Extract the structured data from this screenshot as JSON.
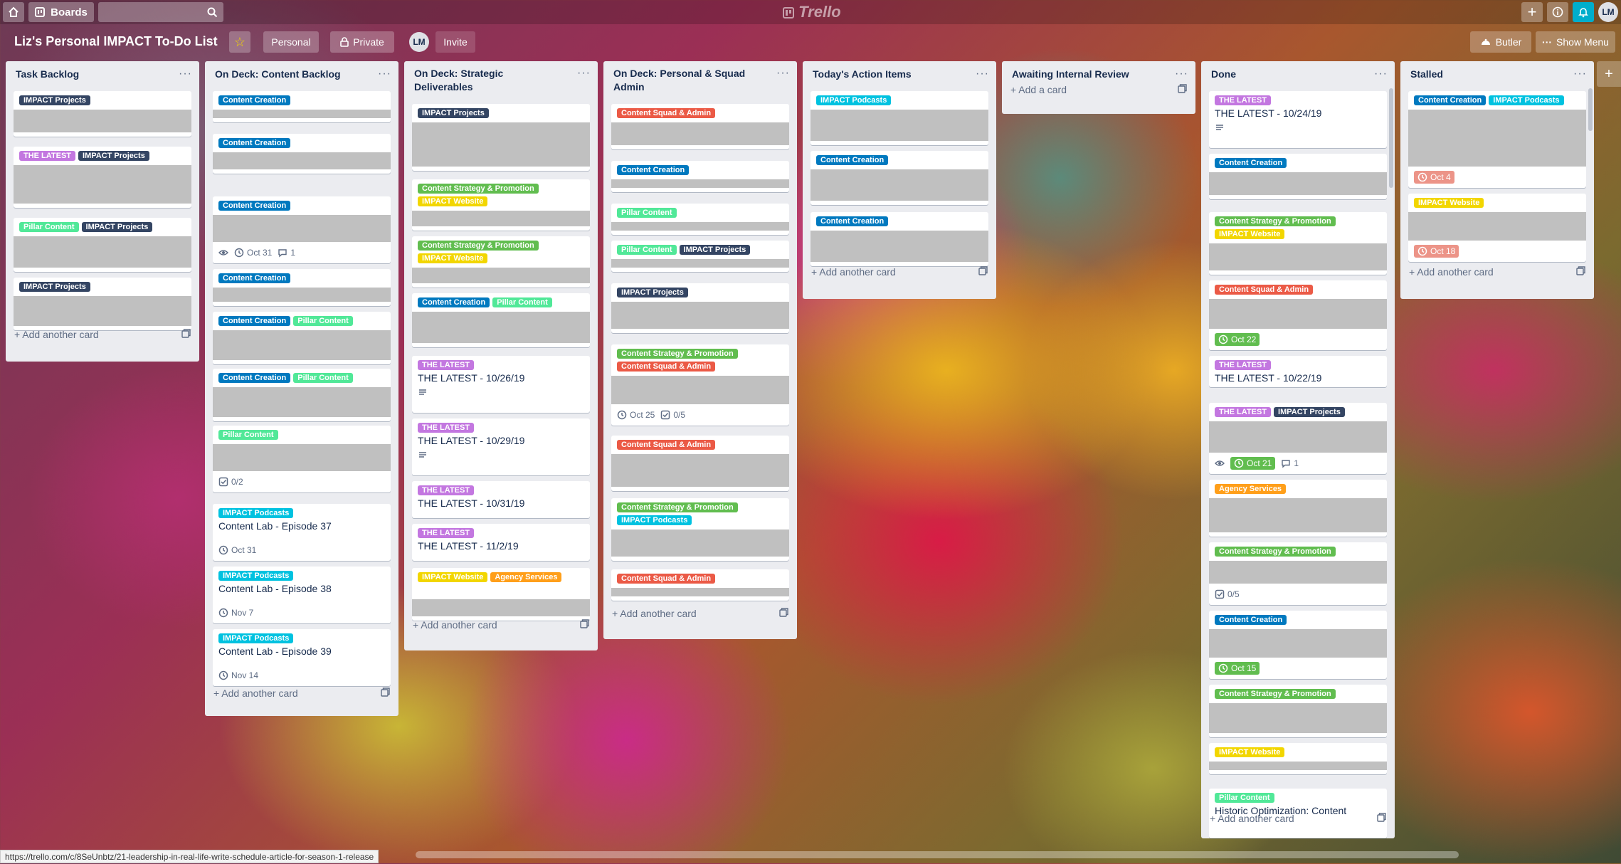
{
  "app": {
    "logo": "Trello"
  },
  "topbar": {
    "boards_label": "Boards",
    "avatar_initials": "LM"
  },
  "board": {
    "title": "Liz's Personal IMPACT To-Do List",
    "team_label": "Personal",
    "visibility_label": "Private",
    "invite_label": "Invite",
    "member_initials": "LM",
    "butler_label": "Butler",
    "show_menu_label": "Show Menu"
  },
  "colors": {
    "green": "#61bd4f",
    "yellow": "#f2d600",
    "orange": "#ff9f1a",
    "red": "#eb5a46",
    "purple": "#c377e0",
    "sky": "#00c2e0",
    "lime": "#51e898",
    "blue": "#0079bf",
    "navy": "#344563",
    "due_complete": "#61bd4f",
    "due_overdue": "#ec9488"
  },
  "lists": [
    {
      "title": "Task Backlog",
      "add_label": "Add another card",
      "cards": [
        {
          "labels": [
            [
              "IMPACT Projects",
              "navy"
            ]
          ]
        },
        {
          "labels": [
            [
              "THE LATEST",
              "purple"
            ],
            [
              "IMPACT Projects",
              "navy"
            ]
          ]
        },
        {
          "labels": [
            [
              "Pillar Content",
              "lime"
            ],
            [
              "IMPACT Projects",
              "navy"
            ]
          ]
        },
        {
          "labels": [
            [
              "IMPACT Projects",
              "navy"
            ]
          ]
        }
      ]
    },
    {
      "title": "On Deck: Content Backlog",
      "add_label": "Add another card",
      "cards": [
        {
          "labels": [
            [
              "Content Creation",
              "blue"
            ]
          ]
        },
        {
          "labels": [
            [
              "Content Creation",
              "blue"
            ]
          ]
        },
        {
          "labels": [
            [
              "Content Creation",
              "blue"
            ]
          ],
          "badges": {
            "due": "Oct 31",
            "comments": "1"
          }
        },
        {
          "labels": [
            [
              "Content Creation",
              "blue"
            ]
          ]
        },
        {
          "labels": [
            [
              "Content Creation",
              "blue"
            ],
            [
              "Pillar Content",
              "lime"
            ]
          ]
        },
        {
          "labels": [
            [
              "Content Creation",
              "blue"
            ],
            [
              "Pillar Content",
              "lime"
            ]
          ]
        },
        {
          "labels": [
            [
              "Pillar Content",
              "lime"
            ]
          ],
          "badges": {
            "checklist": "0/2"
          }
        },
        {
          "labels": [
            [
              "IMPACT Podcasts",
              "sky"
            ]
          ],
          "title": "Content Lab - Episode 37",
          "badges": {
            "due": "Oct 31"
          }
        },
        {
          "labels": [
            [
              "IMPACT Podcasts",
              "sky"
            ]
          ],
          "title": "Content Lab - Episode 38",
          "badges": {
            "due": "Nov 7"
          }
        },
        {
          "labels": [
            [
              "IMPACT Podcasts",
              "sky"
            ]
          ],
          "title": "Content Lab - Episode 39",
          "badges": {
            "due": "Nov 14"
          }
        }
      ]
    },
    {
      "title": "On Deck: Strategic Deliverables",
      "add_label": "Add another card",
      "cards": [
        {
          "labels": [
            [
              "IMPACT Projects",
              "navy"
            ]
          ]
        },
        {
          "labels": [
            [
              "Content Strategy & Promotion",
              "green"
            ],
            [
              "IMPACT Website",
              "yellow"
            ]
          ]
        },
        {
          "labels": [
            [
              "Content Strategy & Promotion",
              "green"
            ],
            [
              "IMPACT Website",
              "yellow"
            ]
          ]
        },
        {
          "labels": [
            [
              "Content Creation",
              "blue"
            ],
            [
              "Pillar Content",
              "lime"
            ]
          ]
        },
        {
          "labels": [
            [
              "THE LATEST",
              "purple"
            ]
          ],
          "title": "THE LATEST - 10/26/19"
        },
        {
          "labels": [
            [
              "THE LATEST",
              "purple"
            ]
          ],
          "title": "THE LATEST - 10/29/19"
        },
        {
          "labels": [
            [
              "THE LATEST",
              "purple"
            ]
          ],
          "title": "THE LATEST - 10/31/19"
        },
        {
          "labels": [
            [
              "THE LATEST",
              "purple"
            ]
          ],
          "title": "THE LATEST - 11/2/19"
        },
        {
          "labels": [
            [
              "IMPACT Website",
              "yellow"
            ],
            [
              "Agency Services",
              "orange"
            ]
          ]
        }
      ]
    },
    {
      "title": "On Deck: Personal & Squad Admin",
      "add_label": "Add another card",
      "cards": [
        {
          "labels": [
            [
              "Content Squad & Admin",
              "red"
            ]
          ]
        },
        {
          "labels": [
            [
              "Content Creation",
              "blue"
            ]
          ]
        },
        {
          "labels": [
            [
              "Pillar Content",
              "lime"
            ]
          ]
        },
        {
          "labels": [
            [
              "Pillar Content",
              "lime"
            ],
            [
              "IMPACT Projects",
              "navy"
            ]
          ]
        },
        {
          "labels": [
            [
              "IMPACT Projects",
              "navy"
            ]
          ]
        },
        {
          "labels": [
            [
              "Content Strategy & Promotion",
              "green"
            ],
            [
              "Content Squad & Admin",
              "red"
            ]
          ],
          "badges": {
            "due": "Oct 25",
            "checklist": "0/5"
          }
        },
        {
          "labels": [
            [
              "Content Squad & Admin",
              "red"
            ]
          ]
        },
        {
          "labels": [
            [
              "Content Strategy & Promotion",
              "green"
            ],
            [
              "IMPACT Podcasts",
              "sky"
            ]
          ]
        },
        {
          "labels": [
            [
              "Content Squad & Admin",
              "red"
            ]
          ]
        }
      ]
    },
    {
      "title": "Today's Action Items",
      "add_label": "Add another card",
      "cards": [
        {
          "labels": [
            [
              "IMPACT Podcasts",
              "sky"
            ]
          ]
        },
        {
          "labels": [
            [
              "Content Creation",
              "blue"
            ]
          ]
        },
        {
          "labels": [
            [
              "Content Creation",
              "blue"
            ]
          ]
        }
      ]
    },
    {
      "title": "Awaiting Internal Review",
      "add_label": "Add a card",
      "cards": []
    },
    {
      "title": "Done",
      "add_label": "Add another card",
      "cards": [
        {
          "labels": [
            [
              "THE LATEST",
              "purple"
            ]
          ],
          "title": "THE LATEST - 10/24/19"
        },
        {
          "labels": [
            [
              "Content Creation",
              "blue"
            ]
          ]
        },
        {
          "labels": [
            [
              "Content Strategy & Promotion",
              "green"
            ],
            [
              "IMPACT Website",
              "yellow"
            ]
          ]
        },
        {
          "labels": [
            [
              "Content Squad & Admin",
              "red"
            ]
          ],
          "badges": {
            "due": "Oct 22"
          }
        },
        {
          "labels": [
            [
              "THE LATEST",
              "purple"
            ]
          ],
          "title": "THE LATEST - 10/22/19"
        },
        {
          "labels": [
            [
              "THE LATEST",
              "purple"
            ],
            [
              "IMPACT Projects",
              "navy"
            ]
          ],
          "badges": {
            "due": "Oct 21",
            "comments": "1"
          }
        },
        {
          "labels": [
            [
              "Agency Services",
              "orange"
            ]
          ]
        },
        {
          "labels": [
            [
              "Content Strategy & Promotion",
              "green"
            ]
          ],
          "badges": {
            "checklist": "0/5"
          }
        },
        {
          "labels": [
            [
              "Content Creation",
              "blue"
            ]
          ],
          "badges": {
            "due": "Oct 15"
          }
        },
        {
          "labels": [
            [
              "Content Strategy & Promotion",
              "green"
            ]
          ]
        },
        {
          "labels": [
            [
              "IMPACT Website",
              "yellow"
            ]
          ]
        },
        {
          "labels": [
            [
              "Pillar Content",
              "lime"
            ]
          ],
          "title": "Historic Optimization: Content"
        }
      ]
    },
    {
      "title": "Stalled",
      "add_label": "Add another card",
      "cards": [
        {
          "labels": [
            [
              "Content Creation",
              "blue"
            ],
            [
              "IMPACT Podcasts",
              "sky"
            ]
          ],
          "badges": {
            "due": "Oct 4"
          }
        },
        {
          "labels": [
            [
              "IMPACT Website",
              "yellow"
            ]
          ],
          "badges": {
            "due": "Oct 18"
          }
        }
      ]
    }
  ],
  "status_url": "https://trello.com/c/8SeUnbtz/21-leadership-in-real-life-write-schedule-article-for-season-1-release"
}
